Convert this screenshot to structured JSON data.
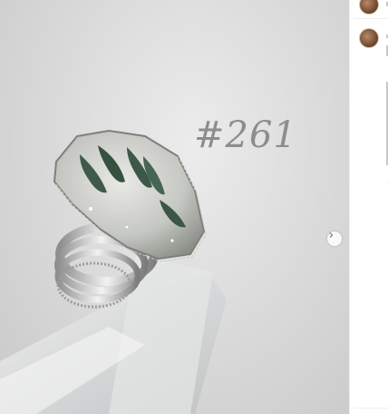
{
  "post": {
    "overlay_number": "#261",
    "next_icon": "chevron-right-icon"
  },
  "side_panel": {
    "top_avatar_icon": "avatar-icon",
    "caption_avatar_icon": "avatar-icon"
  }
}
